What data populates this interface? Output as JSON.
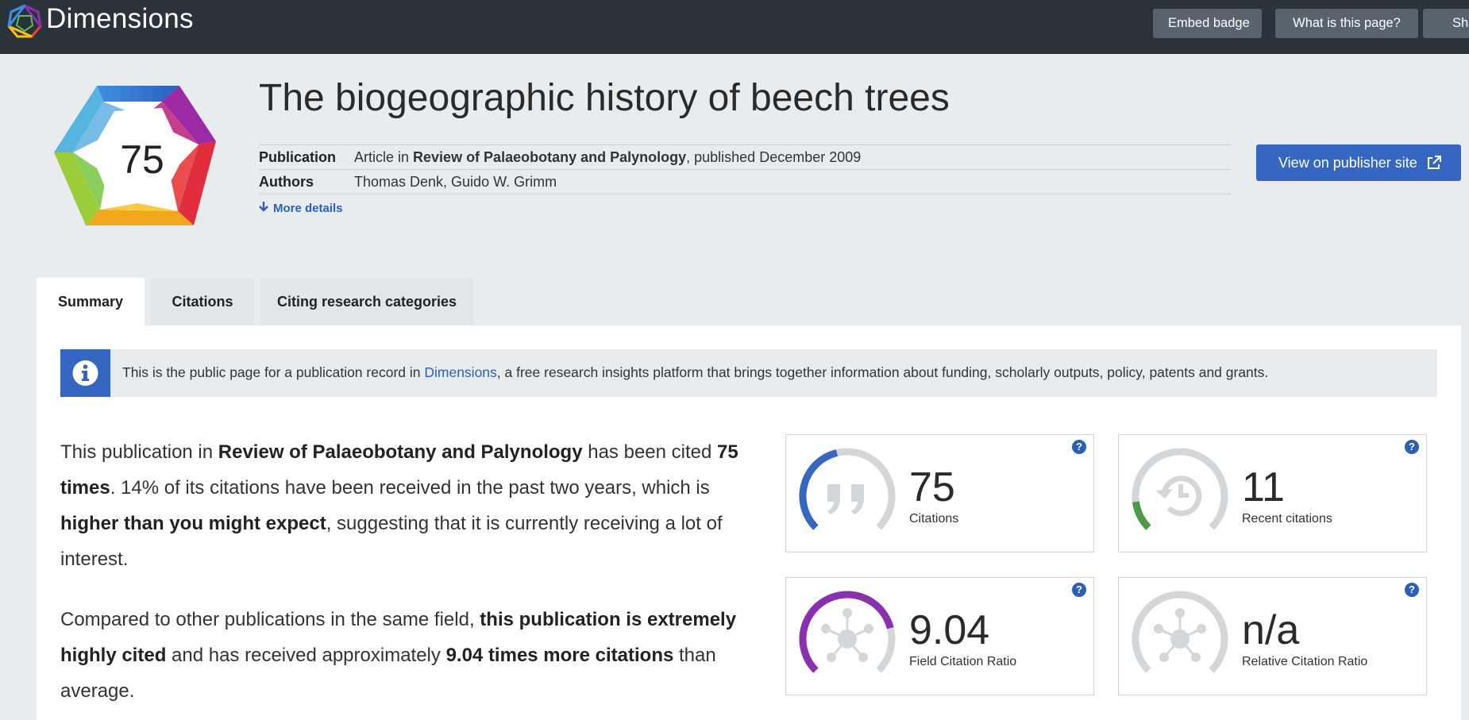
{
  "brand": "Dimensions",
  "top_buttons": {
    "embed": "Embed badge",
    "what": "What is this page?",
    "share": "Share"
  },
  "badge": {
    "score": "75"
  },
  "title": "The biogeographic history of beech trees",
  "meta": {
    "publication_label": "Publication",
    "publication_prefix": "Article in ",
    "publication_journal": "Review of Palaeobotany and Palynology",
    "publication_suffix": ", published December 2009",
    "authors_label": "Authors",
    "authors_value": "Thomas Denk, Guido W. Grimm",
    "more_details": "More details"
  },
  "publisher_button": "View on publisher site",
  "tabs": [
    "Summary",
    "Citations",
    "Citing research categories"
  ],
  "info": {
    "before": "This is the public page for a publication record in ",
    "link": "Dimensions",
    "after": ", a free research insights platform that brings together information about funding, scholarly outputs, policy, patents and grants."
  },
  "summary1": {
    "t1": "This publication in ",
    "b1": "Review of Palaeobotany and Palynology",
    "t2": " has been cited ",
    "b2": "75 times",
    "t3": ". 14% of its citations have been received in the past two years, which is ",
    "b3": "higher than you might expect",
    "t4": ", suggesting that it is currently receiving a lot of interest."
  },
  "summary2": {
    "t1": "Compared to other publications in the same field, ",
    "b1": "this publication is extremely highly cited",
    "t2": " and has received approximately ",
    "b2": "9.04 times more citations",
    "t3": " than average."
  },
  "cards": [
    {
      "value": "75",
      "label": "Citations",
      "color": "#3466c2",
      "fill": 0.45
    },
    {
      "value": "11",
      "label": "Recent citations",
      "color": "#4e9a46",
      "fill": 0.14
    },
    {
      "value": "9.04",
      "label": "Field Citation Ratio",
      "color": "#8a2fb0",
      "fill": 0.78
    },
    {
      "value": "n/a",
      "label": "Relative Citation Ratio",
      "color": "#3466c2",
      "fill": 0
    }
  ],
  "help_symbol": "?"
}
